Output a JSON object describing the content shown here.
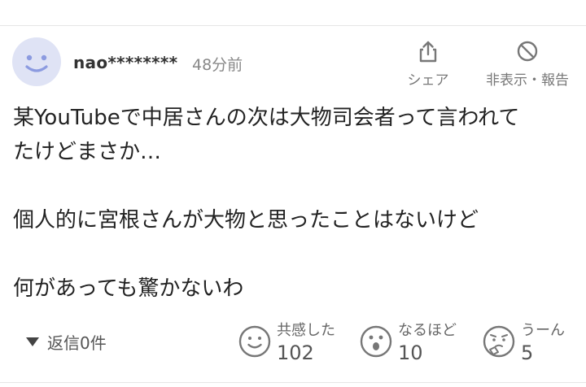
{
  "comment": {
    "username": "nao********",
    "timestamp": "48分前",
    "avatar_icon": "smiley-avatar-icon",
    "avatar_color": "#dfe3f5",
    "actions": {
      "share_label": "シェア",
      "share_icon": "share-icon",
      "hide_report_label": "非表示・報告",
      "hide_icon": "block-icon"
    },
    "body_lines": [
      "某YouTubeで中居さんの次は大物司会者って言われて",
      "たけどまさか…",
      "",
      "個人的に宮根さんが大物と思ったことはないけど",
      "",
      "何があっても驚かないわ"
    ],
    "replies_label": "返信0件",
    "reactions": [
      {
        "label": "共感した",
        "count": "102",
        "icon": "smile-face-icon"
      },
      {
        "label": "なるほど",
        "count": "10",
        "icon": "surprised-face-icon"
      },
      {
        "label": "うーん",
        "count": "5",
        "icon": "thinking-face-icon"
      }
    ]
  }
}
